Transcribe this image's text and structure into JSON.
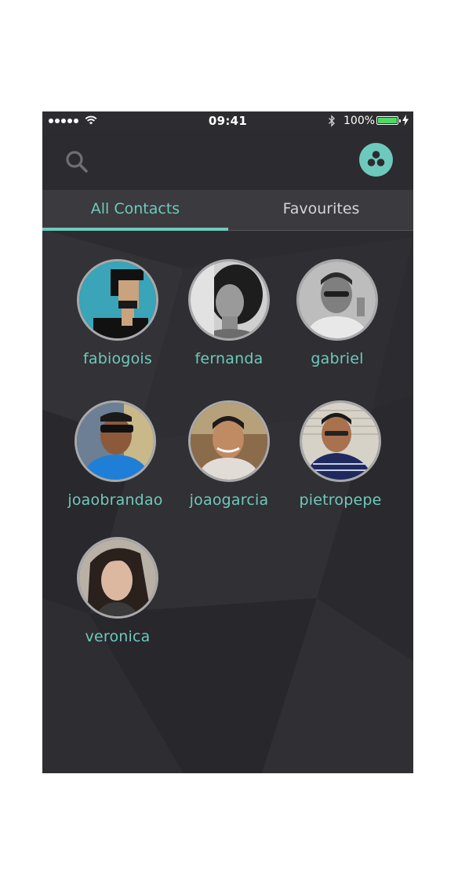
{
  "status_bar": {
    "time": "09:41",
    "battery_percent": "100%",
    "signal_bars": 5
  },
  "header": {
    "search_icon": "search-icon",
    "group_icon": "group-circles-icon"
  },
  "tabs": [
    {
      "label": "All Contacts",
      "active": true
    },
    {
      "label": "Favourites",
      "active": false
    }
  ],
  "contacts": [
    {
      "name": "fabiogois"
    },
    {
      "name": "fernanda"
    },
    {
      "name": "gabriel"
    },
    {
      "name": "joaobrandao"
    },
    {
      "name": "joaogarcia"
    },
    {
      "name": "pietropepe"
    },
    {
      "name": "veronica"
    }
  ],
  "colors": {
    "accent": "#6ec9bd",
    "background": "#2c2b2f",
    "tab_bar": "#3b3a3e"
  }
}
